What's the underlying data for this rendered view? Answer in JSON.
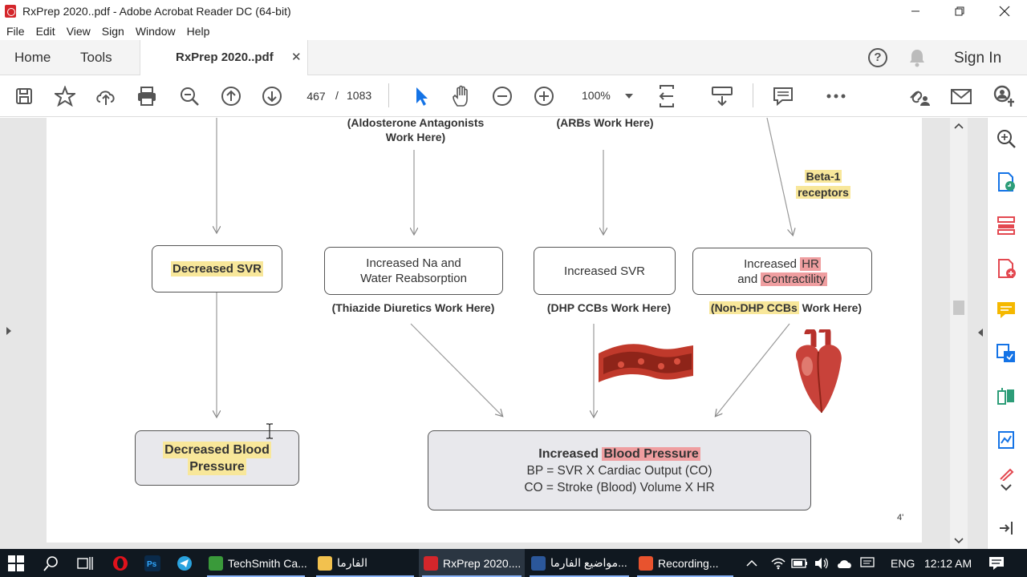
{
  "window": {
    "title": "RxPrep 2020..pdf - Adobe Acrobat Reader DC (64-bit)"
  },
  "menu": [
    "File",
    "Edit",
    "View",
    "Sign",
    "Window",
    "Help"
  ],
  "tabs": {
    "home": "Home",
    "tools": "Tools",
    "document": "RxPrep 2020..pdf",
    "close": "✕"
  },
  "header": {
    "help": "?",
    "sign_in": "Sign In"
  },
  "toolbar": {
    "current_page": "467",
    "separator": "/",
    "total_pages": "1083",
    "zoom": "100%"
  },
  "diagram": {
    "top_labels": {
      "aldosterone": "(Aldosterone Antagonists Work Here)",
      "arbs": "(ARBs Work Here)",
      "beta1_line1": "Beta-1",
      "beta1_line2": "receptors"
    },
    "boxes": {
      "decreased_svr": "Decreased SVR",
      "na_water_line1": "Increased Na and",
      "na_water_line2": "Water Reabsorption",
      "increased_svr": "Increased SVR",
      "hr_increased": "Increased",
      "hr_hr": "HR",
      "hr_and": "and",
      "hr_contractility": "Contractility",
      "decreased_bp_line1": "Decreased Blood",
      "decreased_bp_line2": "Pressure",
      "increased_bp_prefix": "Increased",
      "increased_bp_hl": "Blood Pressure",
      "bp_formula": "BP = SVR X Cardiac Output (CO)",
      "co_formula": "CO = Stroke (Blood) Volume X HR"
    },
    "mid_labels": {
      "thiazide": "(Thiazide Diuretics Work Here)",
      "dhp": "(DHP CCBs Work Here)",
      "non_dhp_hl": "(Non-DHP CCBs",
      "non_dhp_rest": "Work Here)"
    },
    "page_corner": "4'"
  },
  "taskbar": {
    "apps": [
      {
        "label": "TechSmith Ca..."
      },
      {
        "label": "الفارما"
      },
      {
        "label": "RxPrep 2020...."
      },
      {
        "label": "مواضيع الفارما..."
      },
      {
        "label": "Recording..."
      }
    ],
    "language": "ENG",
    "time": "12:12 AM"
  },
  "colors": {
    "highlight_yellow": "#f8e79a",
    "highlight_red": "#ef9ea0",
    "acrobat_red": "#d4262b",
    "taskbar": "#101820"
  }
}
